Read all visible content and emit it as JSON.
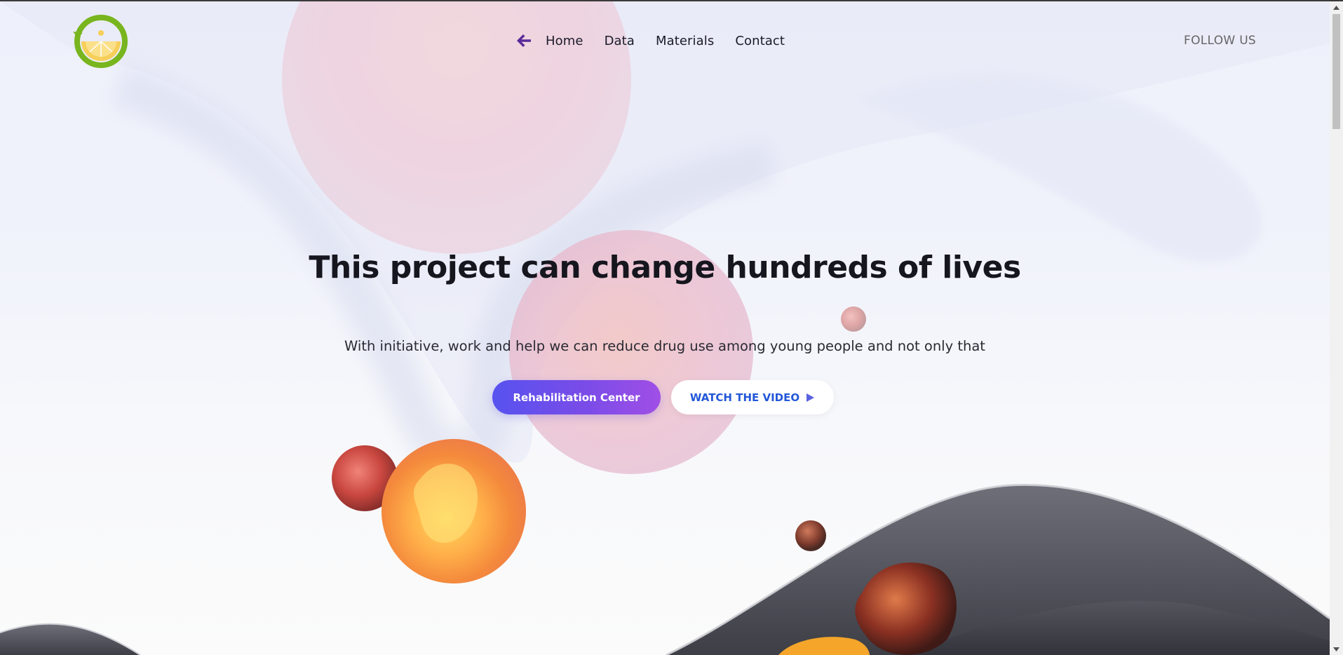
{
  "header": {
    "logo_icon": "lemon-recycle-logo",
    "nav": [
      {
        "label": "Home"
      },
      {
        "label": "Data"
      },
      {
        "label": "Materials"
      },
      {
        "label": "Contact"
      }
    ],
    "back_icon": "arrow-left-icon",
    "follow_label": "FOLLOW US"
  },
  "hero": {
    "title": "This project can change hundreds of lives",
    "subtitle": "With initiative, work and help we can reduce drug use among young people and not only that",
    "primary_button": "Rehabilitation Center",
    "secondary_button": "WATCH THE VIDEO",
    "play_icon": "play-icon"
  },
  "colors": {
    "accent_start": "#5752ef",
    "accent_end": "#a04fe6",
    "link_blue": "#2357d8",
    "back_arrow": "#5a2a9a",
    "logo_green": "#78b51e",
    "logo_yellow": "#f6cf5a"
  }
}
